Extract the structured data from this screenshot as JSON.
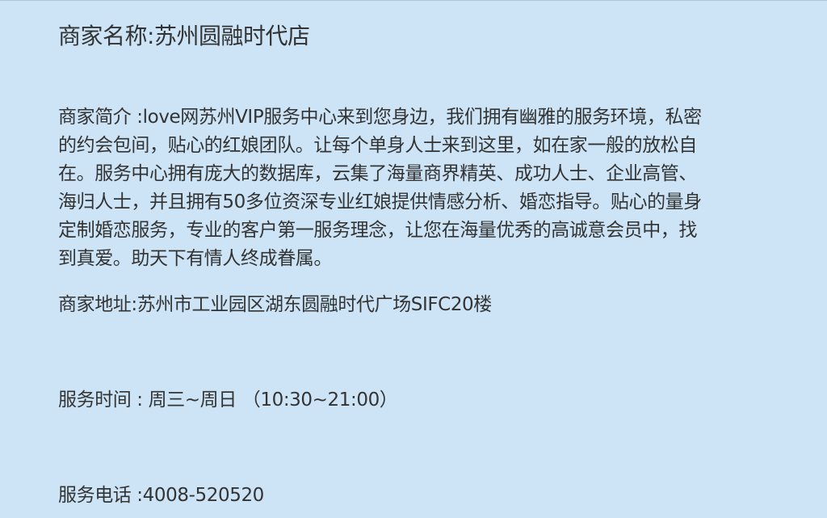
{
  "merchant": {
    "name_label": "商家名称:",
    "name": "苏州圆融时代店",
    "intro_label": "商家简介 :",
    "intro_lines": [
      "love网苏州VIP服务中心来到您身边，我们拥有幽雅的服务环境，私密",
      "的约会包间，贴心的红娘团队。让每个单身人士来到这里，如在家一般的放松自",
      "在。服务中心拥有庞大的数据库，云集了海量商界精英、成功人士、企业高管、",
      "海归人士，并且拥有50多位资深专业红娘提供情感分析、婚恋指导。贴心的量身",
      "定制婚恋服务，专业的客户第一服务理念，让您在海量优秀的高诚意会员中，找",
      "到真爱。助天下有情人终成眷属。"
    ],
    "address_label": "商家地址:",
    "address": "苏州市工业园区湖东圆融时代广场SIFC20楼",
    "hours_label": "服务时间 : ",
    "hours": "周三~周日  （10:30~21:00）",
    "phone_label": "服务电话 :",
    "phone": "4008-520520"
  }
}
